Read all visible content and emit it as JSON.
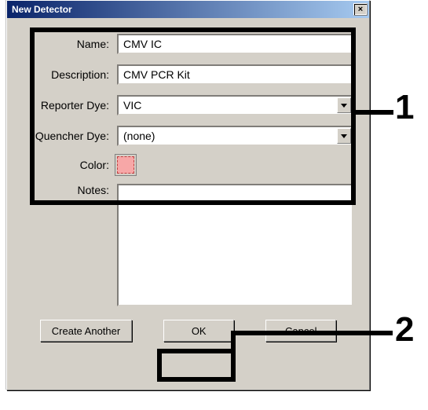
{
  "window": {
    "title": "New Detector",
    "close_glyph": "×"
  },
  "labels": {
    "name": "Name:",
    "description": "Description:",
    "reporter_dye": "Reporter Dye:",
    "quencher_dye": "Quencher Dye:",
    "color": "Color:",
    "notes": "Notes:"
  },
  "fields": {
    "name": "CMV IC",
    "description": "CMV PCR Kit",
    "reporter_dye": "VIC",
    "quencher_dye": "(none)",
    "color": "#f7a7a7",
    "notes": ""
  },
  "buttons": {
    "create_another": "Create Another",
    "ok": "OK",
    "cancel": "Cancel"
  },
  "callouts": {
    "one": "1",
    "two": "2"
  }
}
